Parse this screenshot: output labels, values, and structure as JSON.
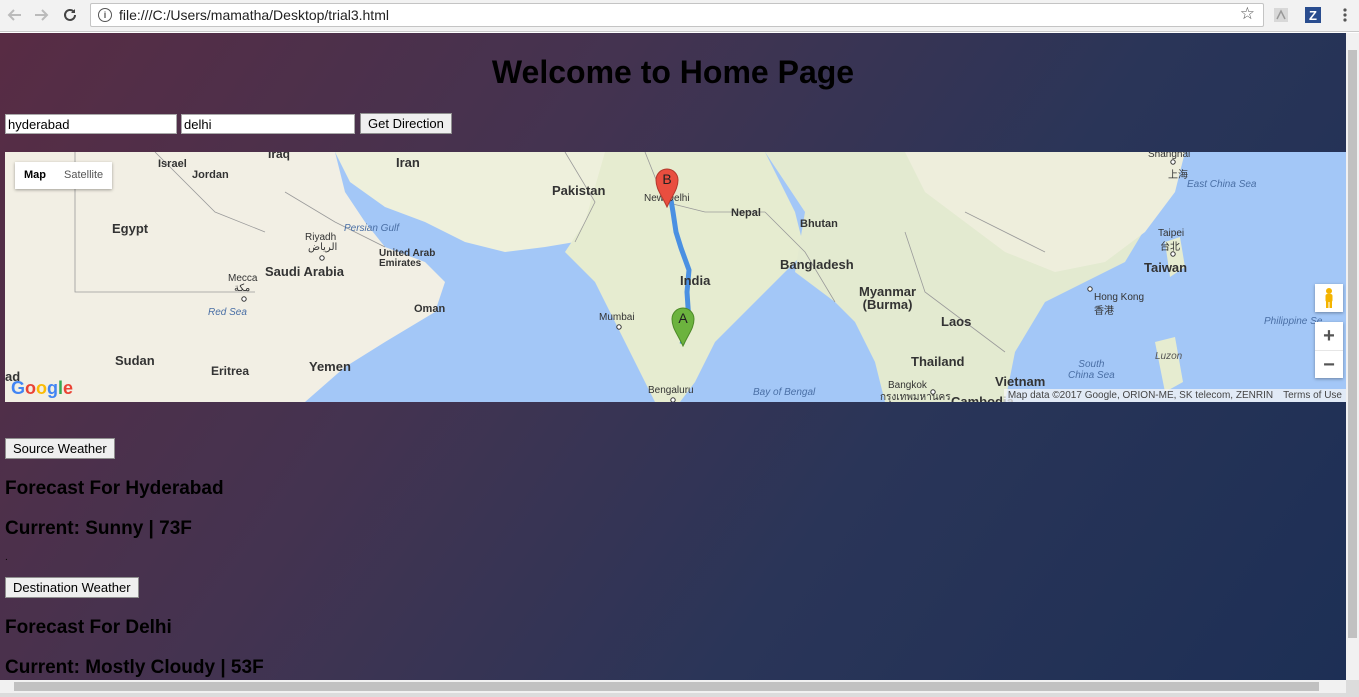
{
  "browser": {
    "url": "file:///C:/Users/mamatha/Desktop/trial3.html"
  },
  "page": {
    "title": "Welcome to Home Page"
  },
  "form": {
    "source_value": "hyderabad",
    "destination_value": "delhi",
    "get_direction_label": "Get Direction"
  },
  "map": {
    "type_map": "Map",
    "type_satellite": "Satellite",
    "zoom_in": "+",
    "zoom_out": "−",
    "attribution": "Map data ©2017 Google, ORION-ME, SK telecom, ZENRIN",
    "terms": "Terms of Use",
    "marker_a": "A",
    "marker_b": "B",
    "labels": {
      "israel": "Israel",
      "iraq": "Iraq",
      "iran": "Iran",
      "jordan": "Jordan",
      "pakistan": "Pakistan",
      "new_delhi": "New Delhi",
      "nepal": "Nepal",
      "bhutan": "Bhutan",
      "shanghai": "Shanghai",
      "shanghai_local": "上海",
      "east_china_sea": "East China Sea",
      "egypt": "Egypt",
      "riyadh": "Riyadh",
      "riyadh_local": "الرياض",
      "persian_gulf": "Persian Gulf",
      "uae": "United Arab\nEmirates",
      "saudi_arabia": "Saudi Arabia",
      "mecca": "Mecca",
      "mecca_local": "مكة",
      "oman": "Oman",
      "red_sea": "Red Sea",
      "india": "India",
      "bangladesh": "Bangladesh",
      "taipei": "Taipei",
      "taipei_local": "台北",
      "taiwan": "Taiwan",
      "myanmar": "Myanmar\n(Burma)",
      "hong_kong": "Hong Kong",
      "hong_kong_local": "香港",
      "mumbai": "Mumbai",
      "laos": "Laos",
      "philippine_sea": "Philippine Se",
      "sudan": "Sudan",
      "eritrea": "Eritrea",
      "yemen": "Yemen",
      "thailand": "Thailand",
      "south_china_sea": "South\nChina Sea",
      "luzon": "Luzon",
      "bengaluru": "Bengaluru",
      "bay_of_bengal": "Bay of Bengal",
      "bangkok": "Bangkok",
      "bangkok_local": "กรุงเทพมหานคร",
      "vietnam": "Vietnam",
      "cambodia": "Cambodia",
      "ad": "ad"
    }
  },
  "weather": {
    "source_button": "Source Weather",
    "source_forecast": "Forecast For Hyderabad",
    "source_current": "Current: Sunny | 73F",
    "separator_dot": ".",
    "destination_button": "Destination Weather",
    "destination_forecast": "Forecast For Delhi",
    "destination_current": "Current: Mostly Cloudy | 53F"
  },
  "icons": {
    "back": "arrow-left-icon",
    "forward": "arrow-right-icon",
    "reload": "reload-icon",
    "info": "info-icon",
    "star": "star-icon",
    "pdf_ext": "pdf-extension-icon",
    "z_ext": "z-extension-icon",
    "menu": "kebab-menu-icon",
    "pegman": "pegman-icon"
  },
  "colors": {
    "route": "#4a90e2",
    "marker_a": "#6cb33e",
    "marker_b": "#e94e3f",
    "water": "#a3c7f7",
    "land": "#f2efe4"
  }
}
